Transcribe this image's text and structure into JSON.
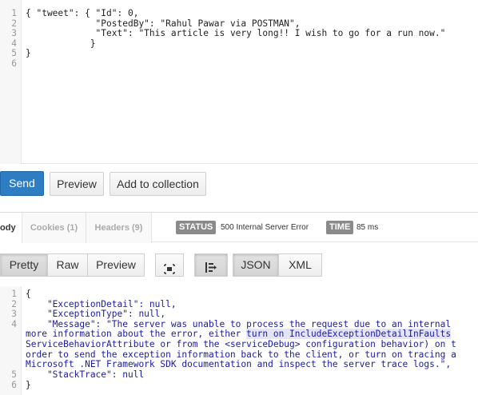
{
  "request": {
    "line_numbers": [
      "1",
      "2",
      "3",
      "4",
      "5",
      "6"
    ],
    "lines": [
      "{ \"tweet\": { \"Id\": 0,",
      "             \"PostedBy\": \"Rahul Pawar via POSTMAN\",",
      "             \"Text\": \"This article is very long!! I wish to go for a run now.\"",
      "            }",
      "}",
      ""
    ]
  },
  "toolbar": {
    "send_label": "Send",
    "preview_label": "Preview",
    "add_collection_label": "Add to collection"
  },
  "response": {
    "tabs": {
      "body": "ody",
      "cookies": "Cookies (1)",
      "headers": "Headers (9)"
    },
    "status_label": "STATUS",
    "status_value": "500 Internal Server Error",
    "time_label": "TIME",
    "time_value": "85 ms",
    "view_modes": {
      "pretty": "Pretty",
      "raw": "Raw",
      "preview": "Preview",
      "json": "JSON",
      "xml": "XML"
    },
    "line_numbers": [
      "1",
      "2",
      "3",
      "4",
      "",
      "",
      "",
      "",
      "5",
      "6"
    ],
    "l1": "{",
    "l2": "    \"ExceptionDetail\": null,",
    "l3": "    \"ExceptionType\": null,",
    "l4a": "    \"Message\": \"The server was unable to process the request due to an internal",
    "l4b_pre": "more information about the error, either ",
    "l4b_hl": "turn on IncludeExceptionDetailInFaults",
    "l4c": "ServiceBehaviorAttribute or from the <serviceDebug> configuration behavior) on t",
    "l4d": "order to send the exception information back to the client, or turn on tracing a",
    "l4e": "Microsoft .NET Framework SDK documentation and inspect the server trace logs.\",",
    "l5": "    \"StackTrace\": null",
    "l6": "}"
  },
  "icons": {
    "fullscreen": "fullscreen-icon",
    "wrap": "wrap-lines-icon"
  }
}
